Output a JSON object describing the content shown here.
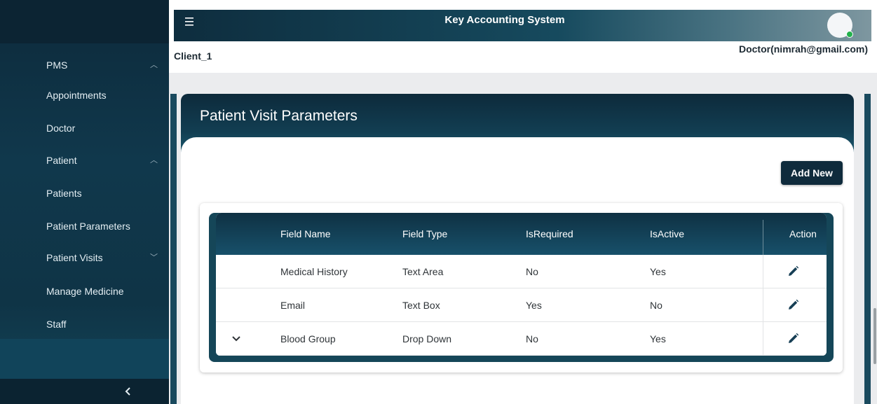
{
  "app": {
    "title": "Key Accounting System",
    "client": "Client_1",
    "user": "Doctor(nimrah@gmail.com)"
  },
  "sidebar": {
    "items": [
      {
        "label": "PMS",
        "caret": "up"
      },
      {
        "label": "Appointments"
      },
      {
        "label": "Doctor"
      },
      {
        "label": "Patient",
        "caret": "up"
      },
      {
        "label": "Patients"
      },
      {
        "label": "Patient Parameters"
      },
      {
        "label": "Patient Visits",
        "caret": "down"
      },
      {
        "label": "Manage Medicine"
      },
      {
        "label": "Staff"
      }
    ]
  },
  "page": {
    "title": "Patient Visit Parameters",
    "add_button": "Add New"
  },
  "table": {
    "columns": [
      "Field Name",
      "Field Type",
      "IsRequired",
      "IsActive",
      "Action"
    ],
    "rows": [
      {
        "field_name": "Medical History",
        "field_type": "Text Area",
        "is_required": "No",
        "is_active": "Yes"
      },
      {
        "field_name": "Email",
        "field_type": "Text Box",
        "is_required": "Yes",
        "is_active": "No"
      },
      {
        "field_name": "Blood Group",
        "field_type": "Drop Down",
        "is_required": "No",
        "is_active": "Yes"
      }
    ]
  },
  "colors": {
    "primary": "#0f2b3c",
    "accent": "#154658",
    "status_online": "#22b14c"
  },
  "icons": [
    "menu-icon",
    "chevron-up-icon",
    "chevron-down-icon",
    "chevron-left-icon",
    "edit-pencil-icon",
    "expand-row-icon",
    "avatar"
  ]
}
